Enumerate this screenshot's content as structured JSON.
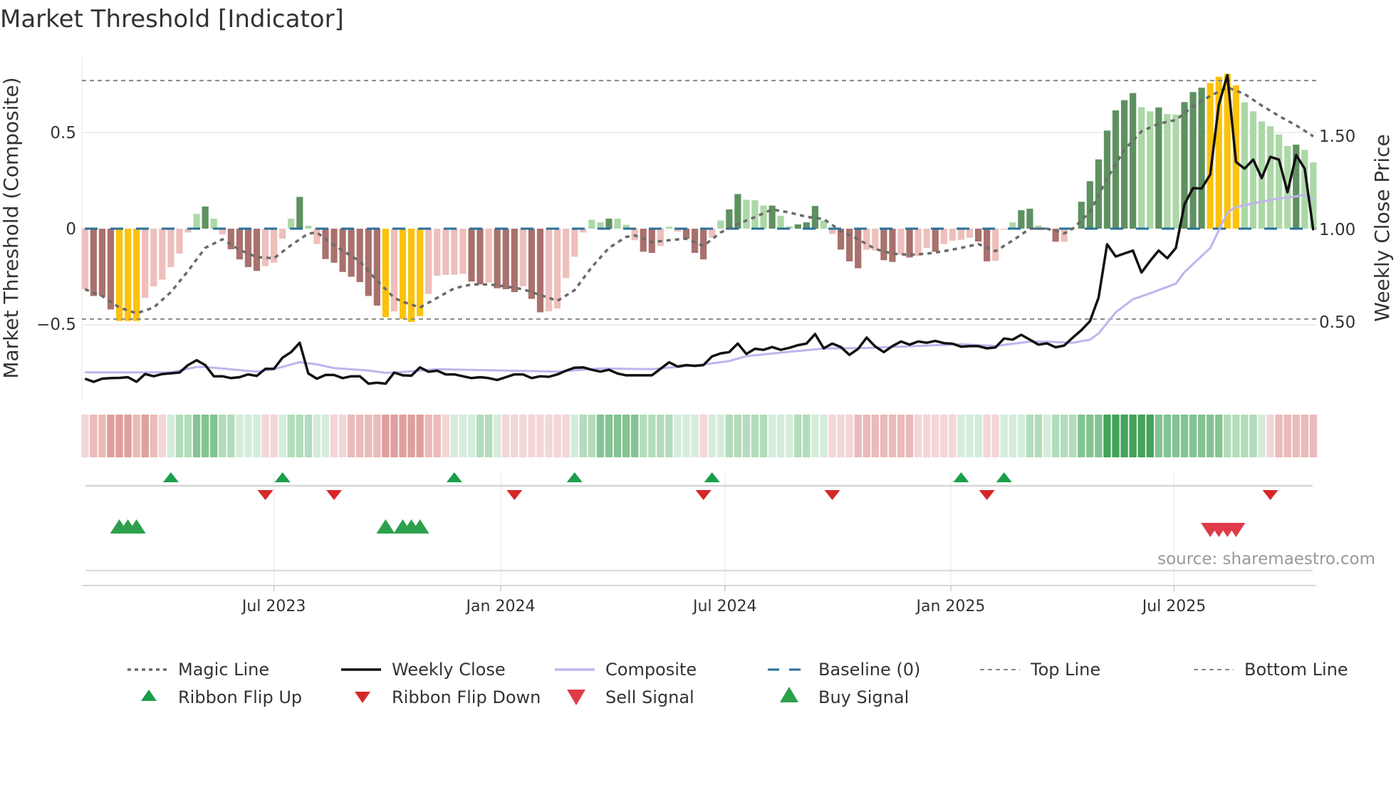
{
  "chart_data": {
    "type": "bar",
    "title": "Market Threshold [Indicator]",
    "ylabel": "Market Threshold (Composite)",
    "ylabel_right": "Weekly Close Price",
    "source": "source: sharemaestro.com",
    "ylim": [
      -0.5,
      0.78
    ],
    "ylim_right": [
      0.12,
      1.9
    ],
    "left_axis": {
      "ticks": [
        {
          "value": 0.5,
          "label": "0.5"
        },
        {
          "value": 0,
          "label": "0"
        },
        {
          "value": -0.5,
          "label": "−0.5"
        }
      ]
    },
    "right_axis": {
      "ticks": [
        {
          "value": 1.5,
          "label": "1.50"
        },
        {
          "value": 1.0,
          "label": "1.00"
        },
        {
          "value": 0.5,
          "label": "0.50"
        }
      ]
    },
    "x_ticks": [
      {
        "week": 22.0,
        "label": "Jul 2023"
      },
      {
        "week": 48.4,
        "label": "Jan 2024"
      },
      {
        "week": 74.5,
        "label": "Jul 2024"
      },
      {
        "week": 100.8,
        "label": "Jan 2025"
      },
      {
        "week": 126.8,
        "label": "Jul 2025"
      }
    ],
    "top_line": 0.77,
    "bottom_line": -0.47,
    "baseline": 0,
    "weeks": 144,
    "bars": {
      "name": "Composite",
      "values": [
        -0.315,
        -0.35,
        -0.35,
        -0.42,
        -0.48,
        -0.48,
        -0.48,
        -0.36,
        -0.3,
        -0.265,
        -0.2,
        -0.13,
        -0.02,
        0.077,
        0.115,
        0.052,
        -0.03,
        -0.107,
        -0.16,
        -0.2,
        -0.22,
        -0.195,
        -0.177,
        -0.052,
        0.052,
        0.165,
        0.015,
        -0.08,
        -0.158,
        -0.177,
        -0.225,
        -0.25,
        -0.278,
        -0.35,
        -0.4,
        -0.46,
        -0.43,
        -0.47,
        -0.485,
        -0.455,
        -0.34,
        -0.245,
        -0.24,
        -0.24,
        -0.235,
        -0.275,
        -0.29,
        -0.28,
        -0.31,
        -0.315,
        -0.33,
        -0.3,
        -0.365,
        -0.435,
        -0.43,
        -0.415,
        -0.257,
        -0.146,
        -0.02,
        0.046,
        0.033,
        0.052,
        0.052,
        0.02,
        -0.06,
        -0.12,
        -0.126,
        -0.09,
        0.01,
        -0.015,
        -0.053,
        -0.126,
        -0.16,
        -0.047,
        0.043,
        0.1,
        0.18,
        0.15,
        0.148,
        0.12,
        0.12,
        0.067,
        0.012,
        0.022,
        0.033,
        0.118,
        0.042,
        -0.028,
        -0.109,
        -0.17,
        -0.206,
        -0.11,
        -0.113,
        -0.164,
        -0.173,
        -0.136,
        -0.15,
        -0.142,
        -0.1,
        -0.12,
        -0.08,
        -0.062,
        -0.058,
        -0.047,
        -0.067,
        -0.17,
        -0.167,
        -0.005,
        0.033,
        0.096,
        0.104,
        0.017,
        0.005,
        -0.068,
        -0.068,
        0.0,
        0.14,
        0.247,
        0.36,
        0.51,
        0.615,
        0.668,
        0.705,
        0.632,
        0.61,
        0.63,
        0.596,
        0.593,
        0.658,
        0.71,
        0.733,
        0.757,
        0.79,
        0.805,
        0.745,
        0.657,
        0.61,
        0.558,
        0.533,
        0.49,
        0.43,
        0.437,
        0.41,
        0.345
      ],
      "states": [
        "lp",
        "dp",
        "dp",
        "dp",
        "gold",
        "gold",
        "gold",
        "lp",
        "lp",
        "lp",
        "lp",
        "lp",
        "lp",
        "lg",
        "dg",
        "lg",
        "lp",
        "dp",
        "dp",
        "dp",
        "dp",
        "lp",
        "lp",
        "lp",
        "lg",
        "dg",
        "lg",
        "lp",
        "dp",
        "dp",
        "dp",
        "dp",
        "dp",
        "dp",
        "dp",
        "gold",
        "lp",
        "gold",
        "gold",
        "gold",
        "lp",
        "lp",
        "lp",
        "lp",
        "lp",
        "dp",
        "dp",
        "lp",
        "dp",
        "dp",
        "dp",
        "lp",
        "dp",
        "dp",
        "lp",
        "lp",
        "lp",
        "lp",
        "lp",
        "lg",
        "lg",
        "dg",
        "lg",
        "lg",
        "lp",
        "dp",
        "dp",
        "lp",
        "lg",
        "lp",
        "dp",
        "dp",
        "dp",
        "lp",
        "lg",
        "dg",
        "dg",
        "lg",
        "lg",
        "lg",
        "dg",
        "lg",
        "lg",
        "dg",
        "dg",
        "dg",
        "lg",
        "lp",
        "dp",
        "dp",
        "dp",
        "lp",
        "lp",
        "dp",
        "dp",
        "lp",
        "dp",
        "lp",
        "lp",
        "dp",
        "lp",
        "lp",
        "lp",
        "lp",
        "dp",
        "dp",
        "lp",
        "lp",
        "lg",
        "dg",
        "dg",
        "lg",
        "lg",
        "dp",
        "lp",
        "lp",
        "dg",
        "dg",
        "dg",
        "dg",
        "dg",
        "dg",
        "dg",
        "lg",
        "lg",
        "dg",
        "lg",
        "lg",
        "dg",
        "dg",
        "dg",
        "gold",
        "gold",
        "gold",
        "gold",
        "lg",
        "lg",
        "lg",
        "lg",
        "lg",
        "lg",
        "dg",
        "lg",
        "lg"
      ]
    },
    "magic_line": {
      "x": [
        0,
        2,
        4,
        6,
        8,
        10,
        12,
        14,
        16,
        18,
        20,
        22,
        24,
        26,
        27,
        29,
        32,
        34,
        36,
        37,
        38,
        39,
        41,
        43,
        45,
        47,
        49,
        51,
        53,
        55,
        57,
        59,
        61,
        63,
        64,
        66,
        68,
        70,
        72,
        74,
        76,
        78,
        80,
        82,
        84,
        86,
        88,
        90,
        92,
        94,
        96,
        98,
        100,
        102,
        104,
        106,
        108,
        110,
        112,
        113,
        114,
        115,
        117,
        119,
        121,
        123,
        125,
        127,
        129,
        131,
        133,
        135,
        137,
        139,
        141,
        143
      ],
      "y": [
        -0.315,
        -0.35,
        -0.41,
        -0.44,
        -0.41,
        -0.33,
        -0.22,
        -0.1,
        -0.055,
        -0.11,
        -0.148,
        -0.154,
        -0.086,
        -0.025,
        -0.02,
        -0.086,
        -0.17,
        -0.27,
        -0.36,
        -0.38,
        -0.395,
        -0.41,
        -0.36,
        -0.31,
        -0.29,
        -0.29,
        -0.3,
        -0.315,
        -0.345,
        -0.375,
        -0.32,
        -0.2,
        -0.1,
        -0.043,
        -0.035,
        -0.07,
        -0.06,
        -0.052,
        -0.09,
        -0.02,
        0.025,
        0.06,
        0.1,
        0.084,
        0.062,
        0.05,
        -0.012,
        -0.055,
        -0.105,
        -0.13,
        -0.136,
        -0.13,
        -0.117,
        -0.1,
        -0.08,
        -0.117,
        -0.062,
        0,
        0,
        -0.012,
        -0.025,
        0,
        0.086,
        0.26,
        0.41,
        0.506,
        0.546,
        0.565,
        0.636,
        0.69,
        0.735,
        0.7,
        0.64,
        0.586,
        0.537,
        0.48
      ]
    },
    "weekly_close": [
      0.197,
      0.18,
      0.197,
      0.2,
      0.201,
      0.205,
      0.18,
      0.222,
      0.21,
      0.222,
      0.226,
      0.23,
      0.27,
      0.296,
      0.27,
      0.21,
      0.21,
      0.2,
      0.205,
      0.22,
      0.212,
      0.25,
      0.25,
      0.31,
      0.34,
      0.39,
      0.225,
      0.197,
      0.217,
      0.217,
      0.2,
      0.21,
      0.21,
      0.17,
      0.175,
      0.17,
      0.23,
      0.215,
      0.213,
      0.258,
      0.234,
      0.24,
      0.22,
      0.22,
      0.21,
      0.2,
      0.205,
      0.2,
      0.19,
      0.205,
      0.22,
      0.22,
      0.2,
      0.21,
      0.207,
      0.22,
      0.24,
      0.256,
      0.258,
      0.245,
      0.235,
      0.245,
      0.225,
      0.215,
      0.215,
      0.215,
      0.215,
      0.25,
      0.285,
      0.262,
      0.27,
      0.266,
      0.27,
      0.317,
      0.333,
      0.34,
      0.386,
      0.33,
      0.358,
      0.352,
      0.367,
      0.352,
      0.363,
      0.377,
      0.386,
      0.437,
      0.36,
      0.386,
      0.367,
      0.325,
      0.357,
      0.418,
      0.37,
      0.34,
      0.372,
      0.397,
      0.38,
      0.397,
      0.39,
      0.4,
      0.388,
      0.385,
      0.369,
      0.372,
      0.372,
      0.36,
      0.365,
      0.413,
      0.407,
      0.433,
      0.407,
      0.38,
      0.387,
      0.366,
      0.375,
      0.418,
      0.458,
      0.506,
      0.633,
      0.92,
      0.854,
      0.87,
      0.886,
      0.768,
      0.83,
      0.886,
      0.845,
      0.9,
      1.135,
      1.222,
      1.22,
      1.295,
      1.67,
      1.83,
      1.363,
      1.327,
      1.375,
      1.276,
      1.39,
      1.375,
      1.2,
      1.4,
      1.327,
      0.995
    ],
    "composite_line": {
      "x": [
        0,
        10,
        11,
        13,
        14,
        20,
        22,
        25,
        27,
        29,
        33,
        35,
        37,
        41,
        55,
        60,
        66,
        72,
        75,
        77,
        81,
        84,
        86,
        91,
        98,
        102,
        106,
        110,
        112,
        115,
        117,
        118,
        120,
        122,
        124,
        127,
        128,
        131,
        132,
        133,
        134,
        136,
        137,
        139,
        140,
        142,
        143
      ],
      "y": [
        0.231,
        0.231,
        0.241,
        0.26,
        0.26,
        0.235,
        0.248,
        0.286,
        0.274,
        0.254,
        0.241,
        0.228,
        0.233,
        0.248,
        0.235,
        0.252,
        0.248,
        0.273,
        0.292,
        0.318,
        0.337,
        0.35,
        0.359,
        0.362,
        0.375,
        0.382,
        0.373,
        0.396,
        0.396,
        0.39,
        0.407,
        0.44,
        0.554,
        0.624,
        0.656,
        0.708,
        0.77,
        0.9,
        0.995,
        1.09,
        1.12,
        1.14,
        1.148,
        1.167,
        1.17,
        1.186,
        1.16
      ]
    },
    "ribbon": [
      -1,
      -2,
      -2,
      -3,
      -3,
      -3,
      -2,
      -3,
      -2,
      -1,
      1,
      2,
      2,
      3,
      3,
      3,
      2,
      2,
      1,
      1,
      1,
      -1,
      -1,
      1,
      2,
      2,
      2,
      1,
      1,
      -1,
      -1,
      -2,
      -2,
      -2,
      -2,
      -3,
      -3,
      -3,
      -3,
      -3,
      -2,
      -2,
      -1,
      1,
      1,
      1,
      2,
      2,
      1,
      -1,
      -1,
      -1,
      -1,
      -1,
      -1,
      -1,
      -1,
      1,
      2,
      2,
      3,
      3,
      3,
      3,
      3,
      2,
      2,
      2,
      2,
      1,
      1,
      1,
      -1,
      1,
      1,
      2,
      2,
      2,
      2,
      2,
      1,
      1,
      1,
      2,
      2,
      1,
      1,
      -1,
      -1,
      -1,
      -2,
      -2,
      -2,
      -2,
      -2,
      -2,
      -2,
      -1,
      -1,
      -1,
      -1,
      -1,
      1,
      1,
      1,
      -1,
      -1,
      1,
      1,
      1,
      2,
      2,
      1,
      2,
      2,
      2,
      3,
      3,
      3,
      4,
      4,
      4,
      4,
      4,
      4,
      3,
      3,
      3,
      3,
      3,
      3,
      3,
      3,
      2,
      2,
      2,
      2,
      1,
      -1,
      -2,
      -2,
      -2,
      -2,
      -2
    ],
    "ribbon_flip_up": [
      10,
      23,
      43,
      57,
      73,
      102,
      107
    ],
    "ribbon_flip_down": [
      21,
      29,
      50,
      72,
      87,
      105,
      138
    ],
    "buy_signals": [
      4,
      5,
      6,
      35,
      37,
      38,
      39
    ],
    "sell_signals": [
      131,
      132,
      133,
      134
    ],
    "colors": {
      "dg": "#5e9160",
      "lg": "#acd8a7",
      "dp": "#a9716d",
      "lp": "#eebfbb",
      "gold": "#fcc20c",
      "magic": "#6b6b6b",
      "close": "#111111",
      "composite": "#bdb5ee",
      "baseline": "#2a6f9a",
      "ribbon_pos": [
        "#d6ecdb",
        "#b3dcbc",
        "#84c493",
        "#44a35b"
      ],
      "ribbon_neg": [
        "#f3d6d7",
        "#eabbba",
        "#df9f9d",
        "#d4898a"
      ],
      "flip_up": "#1a9e4a",
      "flip_down": "#d62728",
      "buy": "#2ca04c",
      "sell": "#e03b4a"
    },
    "legend": [
      {
        "label": "Magic Line",
        "key": "magic"
      },
      {
        "label": "Weekly Close",
        "key": "close"
      },
      {
        "label": "Composite",
        "key": "composite"
      },
      {
        "label": "Baseline (0)",
        "key": "baseline"
      },
      {
        "label": "Top Line",
        "key": "top"
      },
      {
        "label": "Bottom Line",
        "key": "bottom"
      },
      {
        "label": "Ribbon Flip Up",
        "key": "flip_up"
      },
      {
        "label": "Ribbon Flip Down",
        "key": "flip_down"
      },
      {
        "label": "Sell Signal",
        "key": "sell"
      },
      {
        "label": "Buy Signal",
        "key": "buy"
      }
    ]
  }
}
